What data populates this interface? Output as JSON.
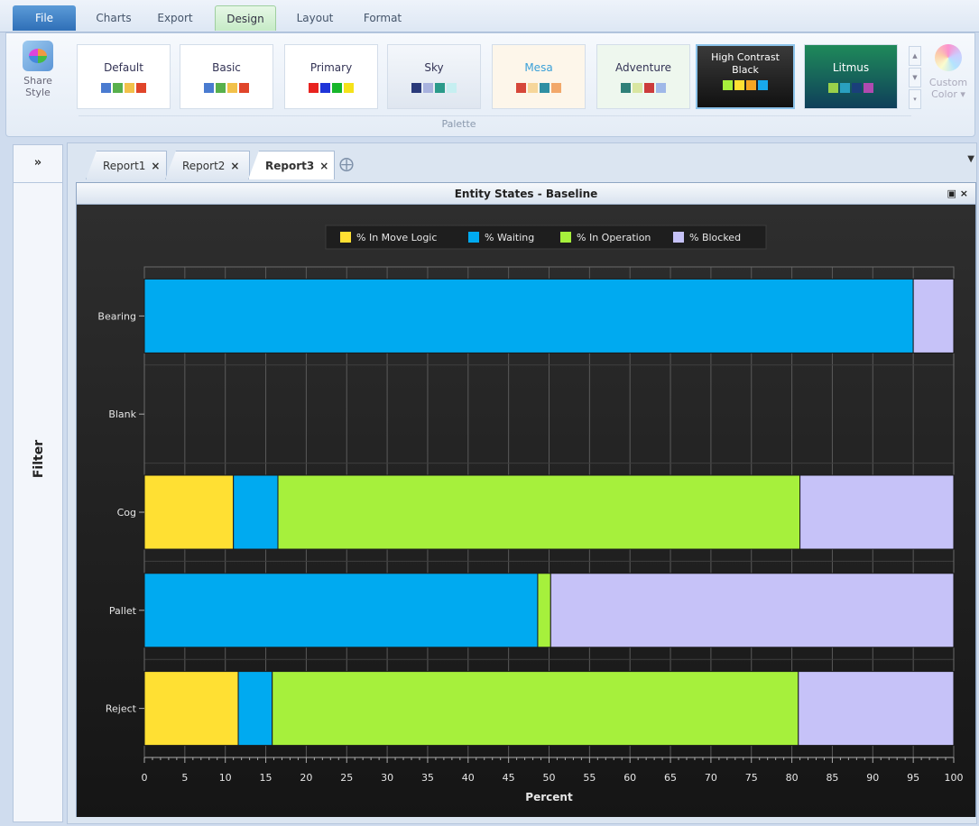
{
  "ribbon_tabs": [
    "File",
    "Charts",
    "Export",
    "Design",
    "Layout",
    "Format"
  ],
  "ribbon": {
    "share_style": "Share Style",
    "palettes": [
      {
        "name": "Default",
        "colors": [
          "#4a7bd0",
          "#58b04c",
          "#f2c14a",
          "#e0452a"
        ]
      },
      {
        "name": "Basic",
        "colors": [
          "#4a7bd0",
          "#58b04c",
          "#f2c14a",
          "#e0452a"
        ]
      },
      {
        "name": "Primary",
        "colors": [
          "#e8231f",
          "#1f35d8",
          "#17b62b",
          "#f5e21a"
        ]
      },
      {
        "name": "Sky",
        "colors": [
          "#2a3a7a",
          "#a8b2de",
          "#2a9a8a",
          "#c6eff1"
        ]
      },
      {
        "name": "Mesa",
        "colors": [
          "#d6473a",
          "#f6d69a",
          "#2f8fa3",
          "#f2a86a"
        ]
      },
      {
        "name": "Adventure",
        "colors": [
          "#2f8078",
          "#d9e6a1",
          "#cc3b3b",
          "#9fb8e8"
        ]
      },
      {
        "name": "High Contrast Black",
        "colors": [
          "#a6f03c",
          "#ffe033",
          "#f5a623",
          "#18a8ec"
        ]
      },
      {
        "name": "Litmus",
        "colors": [
          "#9ad14a",
          "#2aa0c0",
          "#1a3f7a",
          "#b04ab0"
        ]
      }
    ],
    "custom_color": "Custom Color ▾",
    "group_label": "Palette"
  },
  "filter": {
    "toggle": "»",
    "label": "Filter"
  },
  "doc_tabs": [
    {
      "label": "Report1",
      "close": "×"
    },
    {
      "label": "Report2",
      "close": "×"
    },
    {
      "label": "Report3",
      "close": "×"
    }
  ],
  "chart_window": {
    "title": "Entity States - Baseline",
    "buttons": "▣ ×"
  },
  "chart_data": {
    "type": "bar",
    "orientation": "horizontal",
    "stacked": true,
    "categories": [
      "Bearing",
      "Blank",
      "Cog",
      "Pallet",
      "Reject"
    ],
    "series": [
      {
        "name": "% In Move Logic",
        "color": "#ffe033",
        "values": [
          0,
          0,
          11,
          0,
          11.6
        ]
      },
      {
        "name": "% Waiting",
        "color": "#00aaf0",
        "values": [
          95,
          0,
          5.5,
          48.6,
          4.2
        ]
      },
      {
        "name": "% In Operation",
        "color": "#a6f03c",
        "values": [
          0,
          0,
          64.5,
          1.6,
          65
        ]
      },
      {
        "name": "% Blocked",
        "color": "#c6c2f8",
        "values": [
          5,
          0,
          19,
          49.8,
          19.2
        ]
      }
    ],
    "xlabel": "Percent",
    "ylabel": "",
    "xlim": [
      0,
      100
    ],
    "xticks": [
      0,
      5,
      10,
      15,
      20,
      25,
      30,
      35,
      40,
      45,
      50,
      55,
      60,
      65,
      70,
      75,
      80,
      85,
      90,
      95,
      100
    ],
    "legend_position": "top",
    "grid": true
  }
}
